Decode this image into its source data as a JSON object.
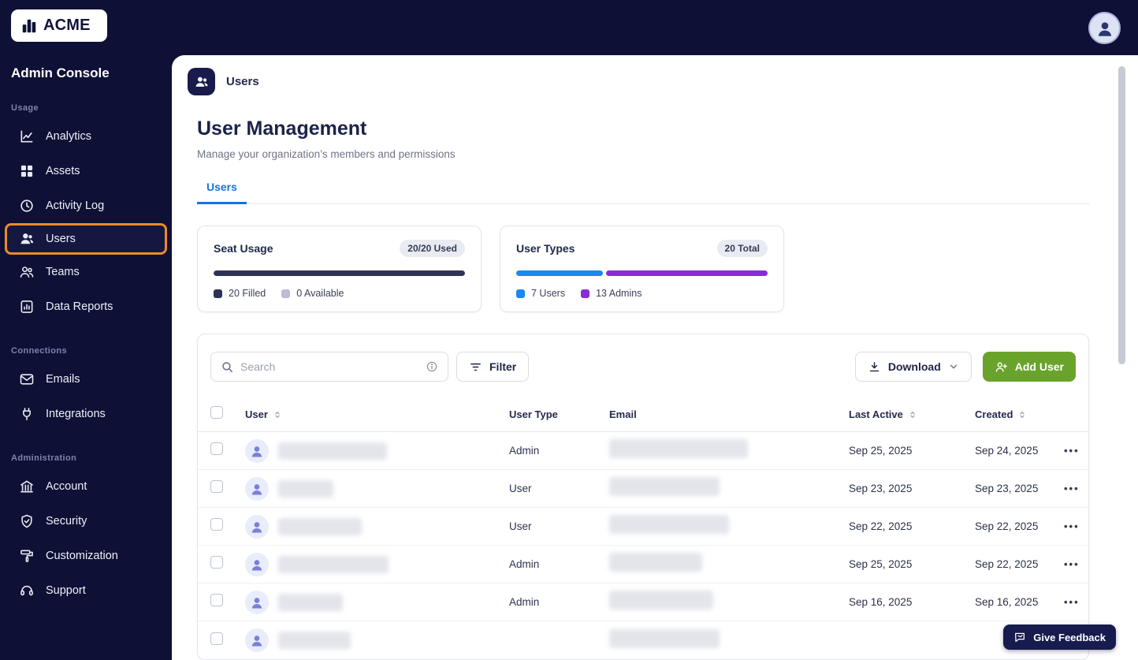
{
  "brand": {
    "logo_text": "ACME"
  },
  "sidebar": {
    "title": "Admin Console",
    "sections": [
      {
        "label": "Usage",
        "items": [
          {
            "label": "Analytics"
          },
          {
            "label": "Assets"
          },
          {
            "label": "Activity Log"
          },
          {
            "label": "Users",
            "active": true
          },
          {
            "label": "Teams"
          },
          {
            "label": "Data Reports"
          }
        ]
      },
      {
        "label": "Connections",
        "items": [
          {
            "label": "Emails"
          },
          {
            "label": "Integrations"
          }
        ]
      },
      {
        "label": "Administration",
        "items": [
          {
            "label": "Account"
          },
          {
            "label": "Security"
          },
          {
            "label": "Customization"
          },
          {
            "label": "Support"
          }
        ]
      }
    ]
  },
  "header": {
    "title": "Users"
  },
  "page": {
    "title": "User Management",
    "subtitle": "Manage your organization’s members and permissions",
    "tabs": [
      {
        "label": "Users",
        "active": true
      }
    ]
  },
  "stats": {
    "seat_usage": {
      "title": "Seat Usage",
      "badge": "20/20 Used",
      "filled_pct": 100,
      "bar_color": "#2e3257",
      "legend": [
        {
          "label": "20 Filled",
          "color": "#2e3257"
        },
        {
          "label": "0 Available",
          "color": "#b9bed4"
        }
      ]
    },
    "user_types": {
      "title": "User Types",
      "badge": "20 Total",
      "segments": [
        {
          "label": "7 Users",
          "color": "#1789f0",
          "pct": 35
        },
        {
          "label": "13 Admins",
          "color": "#8a2bd9",
          "pct": 65
        }
      ]
    }
  },
  "toolbar": {
    "search_placeholder": "Search",
    "filter_label": "Filter",
    "download_label": "Download",
    "add_user_label": "Add User"
  },
  "table": {
    "columns": [
      "User",
      "User Type",
      "Email",
      "Last Active",
      "Created"
    ],
    "rows": [
      {
        "user_type": "Admin",
        "last_active": "Sep 25, 2025",
        "created": "Sep 24, 2025"
      },
      {
        "user_type": "User",
        "last_active": "Sep 23, 2025",
        "created": "Sep 23, 2025"
      },
      {
        "user_type": "User",
        "last_active": "Sep 22, 2025",
        "created": "Sep 22, 2025"
      },
      {
        "user_type": "Admin",
        "last_active": "Sep 25, 2025",
        "created": "Sep 22, 2025"
      },
      {
        "user_type": "Admin",
        "last_active": "Sep 16, 2025",
        "created": "Sep 16, 2025"
      }
    ]
  },
  "feedback": {
    "label": "Give Feedback"
  },
  "colors": {
    "sidebar_bg": "#0e1036",
    "accent_blue": "#1673e0",
    "highlight_orange": "#ec8a2c",
    "add_user_green": "#6aa32c"
  }
}
